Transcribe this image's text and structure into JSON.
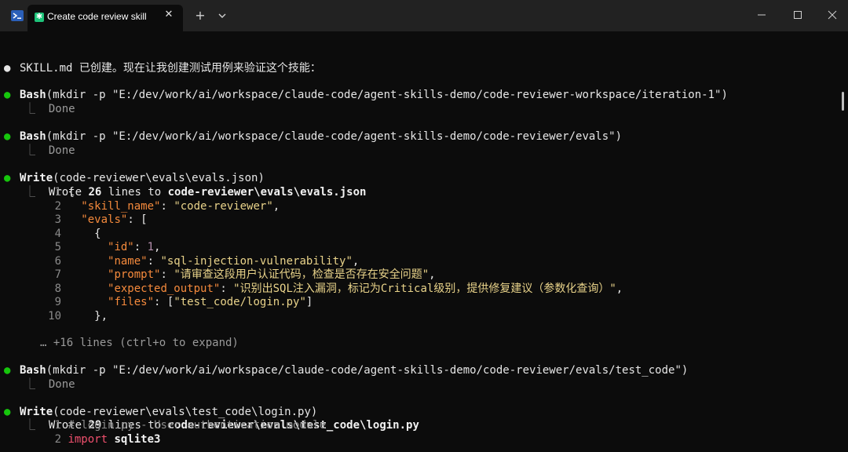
{
  "window": {
    "tab_title": "Create code review skill",
    "tab_icon_glyph": "✱",
    "close_tab_glyph": "✕",
    "new_tab_glyph": "+"
  },
  "terminal": {
    "intro": "SKILL.md 已创建。现在让我创建测试用例来验证这个技能：",
    "blocks": [
      {
        "tool": "Bash",
        "args": "(mkdir -p \"E:/dev/work/ai/workspace/claude-code/agent-skills-demo/code-reviewer-workspace/iteration-1\")",
        "result": "Done"
      },
      {
        "tool": "Bash",
        "args": "(mkdir -p \"E:/dev/work/ai/workspace/claude-code/agent-skills-demo/code-reviewer/evals\")",
        "result": "Done"
      },
      {
        "tool": "Write",
        "args": "(code-reviewer\\evals\\evals.json)",
        "result_prefix": "Wrote ",
        "result_count": "26",
        "result_mid": " lines to ",
        "result_path": "code-reviewer\\evals\\evals.json",
        "code": {
          "l1": {
            "num": "1",
            "p": "{"
          },
          "l2": {
            "num": "2",
            "k": "\"skill_name\"",
            "sep": ": ",
            "v": "\"code-reviewer\"",
            "end": ","
          },
          "l3": {
            "num": "3",
            "k": "\"evals\"",
            "sep": ": ",
            "end": "["
          },
          "l4": {
            "num": "4",
            "p": "{"
          },
          "l5": {
            "num": "5",
            "k": "\"id\"",
            "sep": ": ",
            "v": "1",
            "end": ","
          },
          "l6": {
            "num": "6",
            "k": "\"name\"",
            "sep": ": ",
            "v": "\"sql-injection-vulnerability\"",
            "end": ","
          },
          "l7": {
            "num": "7",
            "k": "\"prompt\"",
            "sep": ": ",
            "v": "\"请审查这段用户认证代码，检查是否存在安全问题\"",
            "end": ","
          },
          "l8": {
            "num": "8",
            "k": "\"expected_output\"",
            "sep": ": ",
            "v": "\"识别出SQL注入漏洞，标记为Critical级别，提供修复建议（参数化查询）\"",
            "end": ","
          },
          "l9": {
            "num": "9",
            "k": "\"files\"",
            "sep": ": ",
            "b1": "[",
            "v": "\"test_code/login.py\"",
            "b2": "]"
          },
          "l10": {
            "num": "10",
            "p": "},"
          }
        },
        "more": "… +16 lines (ctrl+o to expand)"
      },
      {
        "tool": "Bash",
        "args": "(mkdir -p \"E:/dev/work/ai/workspace/claude-code/agent-skills-demo/code-reviewer/evals/test_code\")",
        "result": "Done"
      },
      {
        "tool": "Write",
        "args": "(code-reviewer\\evals\\test_code\\login.py)",
        "result_prefix": "Wrote ",
        "result_count": "29",
        "result_mid": " lines to ",
        "result_path": "code-reviewer\\evals\\test_code\\login.py",
        "code": {
          "l1": {
            "num": "1",
            "comment": "# login.py - User authentication module"
          },
          "l2": {
            "num": "2",
            "kw": "import",
            "rest": " sqlite3"
          }
        }
      }
    ],
    "tree_glyph": "⎿",
    "bullet_glyph": "●"
  },
  "colors": {
    "background": "#0c0c0c",
    "titlebar": "#222222",
    "bullet_green": "#16c60c",
    "json_key": "#f58a3c",
    "json_string": "#e9d38a",
    "keyword": "#f0506e"
  },
  "icons": [
    "terminal-app-icon",
    "tab-skill-icon",
    "close-icon",
    "plus-icon",
    "chevron-down-icon",
    "minimize-icon",
    "maximize-icon",
    "window-close-icon"
  ]
}
